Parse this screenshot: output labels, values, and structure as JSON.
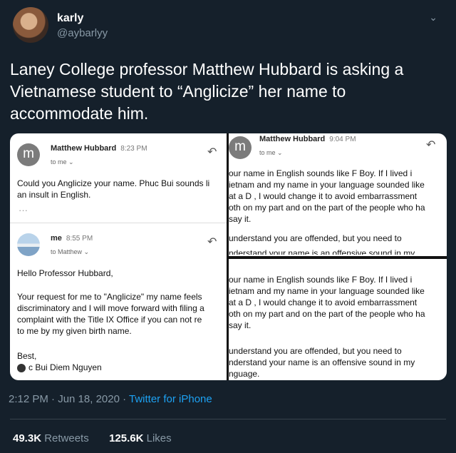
{
  "author": {
    "name": "karly",
    "handle": "@aybarlyy"
  },
  "tweet": {
    "text": "Laney College professor Matthew Hubbard is asking a Vietnamese student to “Anglicize” her name to accommodate him."
  },
  "left_email": {
    "sender": "Matthew Hubbard",
    "time": "8:23 PM",
    "to": "to me ⌄",
    "body_lines": [
      "Could you Anglicize your name. Phuc Bui sounds li",
      "an insult in English."
    ],
    "reply": {
      "sender": "me",
      "time": "8:55 PM",
      "to": "to Matthew ⌄",
      "greeting": "Hello Professor Hubbard,",
      "body_lines": [
        "Your request for me to \"Anglicize\" my name feels",
        "discriminatory and I will move forward with filing a",
        "complaint with the Title IX Office if you can not re",
        "to me by my given birth name."
      ],
      "closing": "Best,",
      "signature": "c Bui Diem Nguyen"
    }
  },
  "right_top": {
    "sender": "Matthew Hubbard",
    "time": "9:04 PM",
    "to": "to me ⌄",
    "lines": [
      "our name in English sounds like F    Boy. If I lived i",
      "ietnam and my name in your language sounded like",
      "at a D   , I would change it to avoid embarrassment",
      "oth on my part and on the part of the people who ha",
      "say it.",
      "understand you are offended, but you need to",
      "nderstand your name is an offensive sound in my"
    ]
  },
  "right_bottom": {
    "lines": [
      "our name in English sounds like F    Boy. If I lived i",
      "ietnam and my name in your language sounded like",
      "at a D   , I would change it to avoid embarrassment",
      "oth on my part and on the part of the people who ha",
      "say it.",
      "understand you are offended, but you need to",
      "nderstand your name is an offensive sound in my",
      "nguage."
    ]
  },
  "meta": {
    "time": "2:12 PM · Jun 18, 2020 · ",
    "source": "Twitter for iPhone"
  },
  "stats": {
    "retweets_count": "49.3K",
    "retweets_label": " Retweets",
    "likes_count": "125.6K",
    "likes_label": " Likes"
  },
  "icons": {
    "reply": "reply-arrow-icon",
    "more": "chevron-down-icon"
  }
}
